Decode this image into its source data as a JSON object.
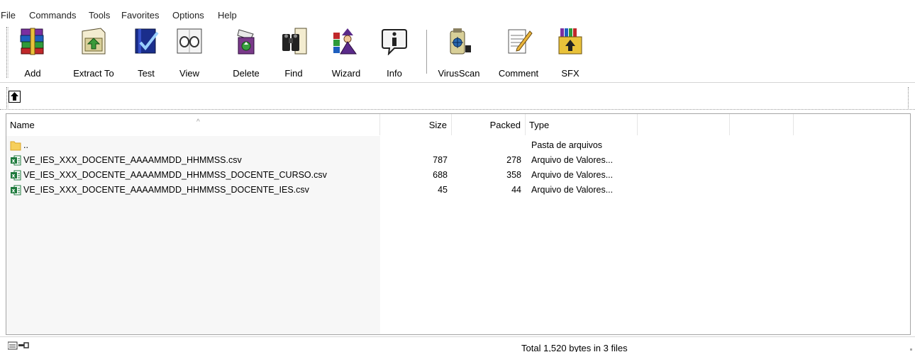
{
  "menu": [
    "File",
    "Commands",
    "Tools",
    "Favorites",
    "Options",
    "Help"
  ],
  "toolbar": {
    "add": "Add",
    "extract_to": "Extract To",
    "test": "Test",
    "view": "View",
    "delete": "Delete",
    "find": "Find",
    "wizard": "Wizard",
    "info": "Info",
    "virusscan": "VirusScan",
    "comment": "Comment",
    "sfx": "SFX"
  },
  "icons": {
    "add": "winrar-books-add-icon",
    "extract_to": "folder-extract-icon",
    "test": "test-check-icon",
    "view": "glasses-view-icon",
    "delete": "recycle-delete-icon",
    "find": "binoculars-find-icon",
    "wizard": "wizard-icon",
    "info": "info-icon",
    "virusscan": "virus-scan-icon",
    "comment": "notepad-comment-icon",
    "sfx": "sfx-box-icon",
    "up": "up-one-level-icon"
  },
  "columns": {
    "name": "Name",
    "size": "Size",
    "packed": "Packed",
    "type": "Type"
  },
  "files": [
    {
      "name": "..",
      "size": "",
      "packed": "",
      "type": "Pasta de arquivos",
      "icon": "folder-icon"
    },
    {
      "name": "VE_IES_XXX_DOCENTE_AAAAMMDD_HHMMSS.csv",
      "size": "787",
      "packed": "278",
      "type": "Arquivo de Valores...",
      "icon": "excel-csv-icon"
    },
    {
      "name": "VE_IES_XXX_DOCENTE_AAAAMMDD_HHMMSS_DOCENTE_CURSO.csv",
      "size": "688",
      "packed": "358",
      "type": "Arquivo de Valores...",
      "icon": "excel-csv-icon"
    },
    {
      "name": "VE_IES_XXX_DOCENTE_AAAAMMDD_HHMMSS_DOCENTE_IES.csv",
      "size": "45",
      "packed": "44",
      "type": "Arquivo de Valores...",
      "icon": "excel-csv-icon"
    }
  ],
  "status": {
    "text": "Total 1,520 bytes in 3 files"
  }
}
